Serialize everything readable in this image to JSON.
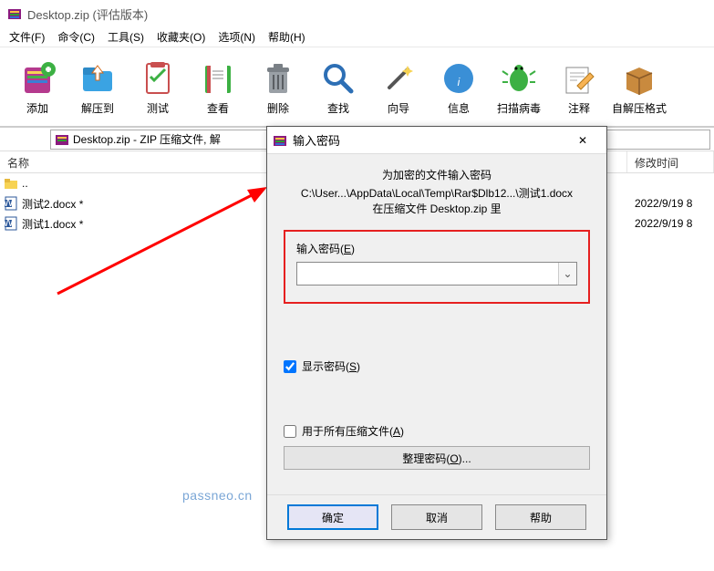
{
  "titlebar": {
    "title": "Desktop.zip (评估版本)"
  },
  "menubar": {
    "file": "文件(F)",
    "commands": "命令(C)",
    "tools": "工具(S)",
    "favorites": "收藏夹(O)",
    "options": "选项(N)",
    "help": "帮助(H)"
  },
  "toolbar": {
    "add": "添加",
    "extract_to": "解压到",
    "test": "测试",
    "view": "查看",
    "delete": "删除",
    "find": "查找",
    "wizard": "向导",
    "info": "信息",
    "virus_scan": "扫描病毒",
    "comment": "注释",
    "sfx": "自解压格式"
  },
  "addressbar": {
    "path": "Desktop.zip - ZIP 压缩文件, 解"
  },
  "list": {
    "col_name": "名称",
    "col_mtime": "修改时间",
    "rows": [
      {
        "name": "..",
        "icon": "folder",
        "mtime": ""
      },
      {
        "name": "测试2.docx *",
        "icon": "docx",
        "mtime": "2022/9/19 8"
      },
      {
        "name": "测试1.docx *",
        "icon": "docx",
        "mtime": "2022/9/19 8"
      }
    ]
  },
  "dialog": {
    "title": "输入密码",
    "line1": "为加密的文件输入密码",
    "path": "C:\\User...\\AppData\\Local\\Temp\\Rar$Dlb12...\\测试1.docx",
    "line2": "在压缩文件 Desktop.zip 里",
    "input_label_pre": "输入密码(",
    "input_label_key": "E",
    "input_label_post": ")",
    "password_value": "",
    "show_pw_pre": "显示密码(",
    "show_pw_key": "S",
    "show_pw_post": ")",
    "show_pw_checked": true,
    "use_all_pre": "用于所有压缩文件(",
    "use_all_key": "A",
    "use_all_post": ")",
    "use_all_checked": false,
    "organize_pre": "整理密码(",
    "organize_key": "O",
    "organize_post": ")...",
    "ok": "确定",
    "cancel": "取消",
    "help": "帮助"
  },
  "watermark": "passneo.cn"
}
